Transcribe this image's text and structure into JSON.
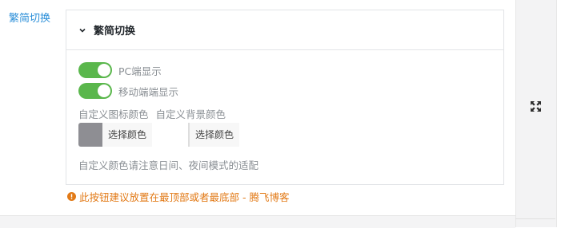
{
  "side_label": "繁简切换",
  "panel": {
    "title": "繁简切换",
    "toggles": [
      {
        "label": "PC端显示",
        "on": true
      },
      {
        "label": "移动端端显示",
        "on": true
      }
    ],
    "color_captions": [
      "自定义图标颜色",
      "自定义背景颜色"
    ],
    "color_pickers": [
      {
        "button_label": "选择颜色",
        "swatch_color": "#8e8e93"
      },
      {
        "button_label": "选择颜色",
        "swatch_color": "#f7f7f7"
      }
    ],
    "hint": "自定义颜色请注意日间、夜间模式的适配"
  },
  "warning": "此按钮建议放置在最顶部或者最底部 - 腾飞博客",
  "colors": {
    "accent_blue": "#2a8ed8",
    "toggle_on": "#5ab74c",
    "warning_orange": "#e27a17"
  },
  "icons": [
    "chevron-down-icon",
    "info-circle-icon",
    "fullscreen-icon"
  ]
}
